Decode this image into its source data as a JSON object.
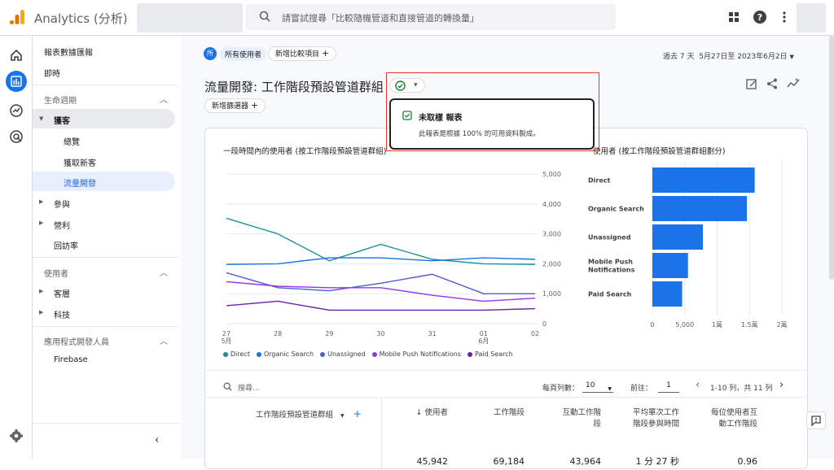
{
  "app": {
    "title": "Analytics (分析)"
  },
  "search": {
    "placeholder": "請嘗試搜尋「比較隨機管道和直接管道的轉換量」"
  },
  "sidebar": {
    "items": [
      {
        "label": "報表數據匯報"
      },
      {
        "label": "即時"
      },
      {
        "label": "生命週期"
      },
      {
        "label": "獲客"
      },
      {
        "label": "總覽"
      },
      {
        "label": "獲取新客"
      },
      {
        "label": "流量開發"
      },
      {
        "label": "參與"
      },
      {
        "label": "營利"
      },
      {
        "label": "回訪率"
      },
      {
        "label": "使用者"
      },
      {
        "label": "客層"
      },
      {
        "label": "科技"
      },
      {
        "label": "應用程式開發人員"
      },
      {
        "label": "Firebase"
      }
    ]
  },
  "filters": {
    "badge": "所",
    "all_users": "所有使用者",
    "add_compare": "新增比較項目",
    "add_filter": "新增篩選器"
  },
  "date": {
    "range_label": "過去 7 天",
    "range": "5月27日至 2023年6月2日"
  },
  "page": {
    "title": "流量開發: 工作階段預設管道群組"
  },
  "popover": {
    "title": "未取樣 報表",
    "body": "此報表是根據 100% 的可用資料製成。"
  },
  "line_chart_title": "一段時間內的使用者 (按工作階段預設管道群組)",
  "bar_chart_title": "使用者 (按工作階段預設管道群組劃分)",
  "table": {
    "search_placeholder": "搜尋...",
    "rows_per_page_label": "每頁列數：",
    "rows_per_page": "10",
    "goto_label": "前往：",
    "goto_value": "1",
    "pagination": "1-10 列，共 11 列",
    "dimension_header": "工作階段預設管道群組",
    "columns": [
      "使用者",
      "工作階段",
      "互動工作階段",
      "平均單次工作階段參與時間",
      "每位使用者互動工作階段"
    ],
    "totals": [
      "45,942",
      "69,184",
      "43,964",
      "1 分 27 秒",
      "0.96"
    ]
  },
  "colors": {
    "accent": "#1a73e8",
    "popover_check": "#188038",
    "highlight": "#e53935"
  },
  "chart_data": [
    {
      "type": "line",
      "title": "一段時間內的使用者 (按工作階段預設管道群組)",
      "x": [
        "27\n5月",
        "28",
        "29",
        "30",
        "31",
        "01\n6月",
        "02"
      ],
      "ylim": [
        0,
        5000
      ],
      "yticks": [
        "5,000",
        "4,000",
        "3,000",
        "2,000",
        "1,000",
        "0"
      ],
      "series": [
        {
          "name": "Direct",
          "color": "#12939a",
          "values": [
            3520,
            3000,
            2100,
            2650,
            2150,
            2000,
            1980
          ]
        },
        {
          "name": "Organic Search",
          "color": "#1a73e8",
          "values": [
            1980,
            2000,
            2200,
            2200,
            2100,
            2200,
            2150
          ]
        },
        {
          "name": "Unassigned",
          "color": "#4c5bd4",
          "values": [
            1700,
            1200,
            1100,
            1350,
            1650,
            1000,
            1000
          ]
        },
        {
          "name": "Mobile Push Notifications",
          "color": "#9334e6",
          "values": [
            1400,
            1250,
            1200,
            1200,
            950,
            750,
            850
          ]
        },
        {
          "name": "Paid Search",
          "color": "#6e1f9d",
          "values": [
            600,
            750,
            450,
            450,
            450,
            450,
            500
          ]
        }
      ]
    },
    {
      "type": "bar",
      "title": "使用者 (按工作階段預設管道群組劃分)",
      "categories": [
        "Direct",
        "Organic Search",
        "Unassigned",
        "Mobile Push Notifications",
        "Paid Search"
      ],
      "values": [
        15800,
        14600,
        7800,
        5500,
        4600
      ],
      "xlim": [
        0,
        20000
      ],
      "xticks": [
        "0",
        "5,000",
        "1萬",
        "1.5萬",
        "2萬"
      ],
      "color": "#1a73e8"
    }
  ]
}
